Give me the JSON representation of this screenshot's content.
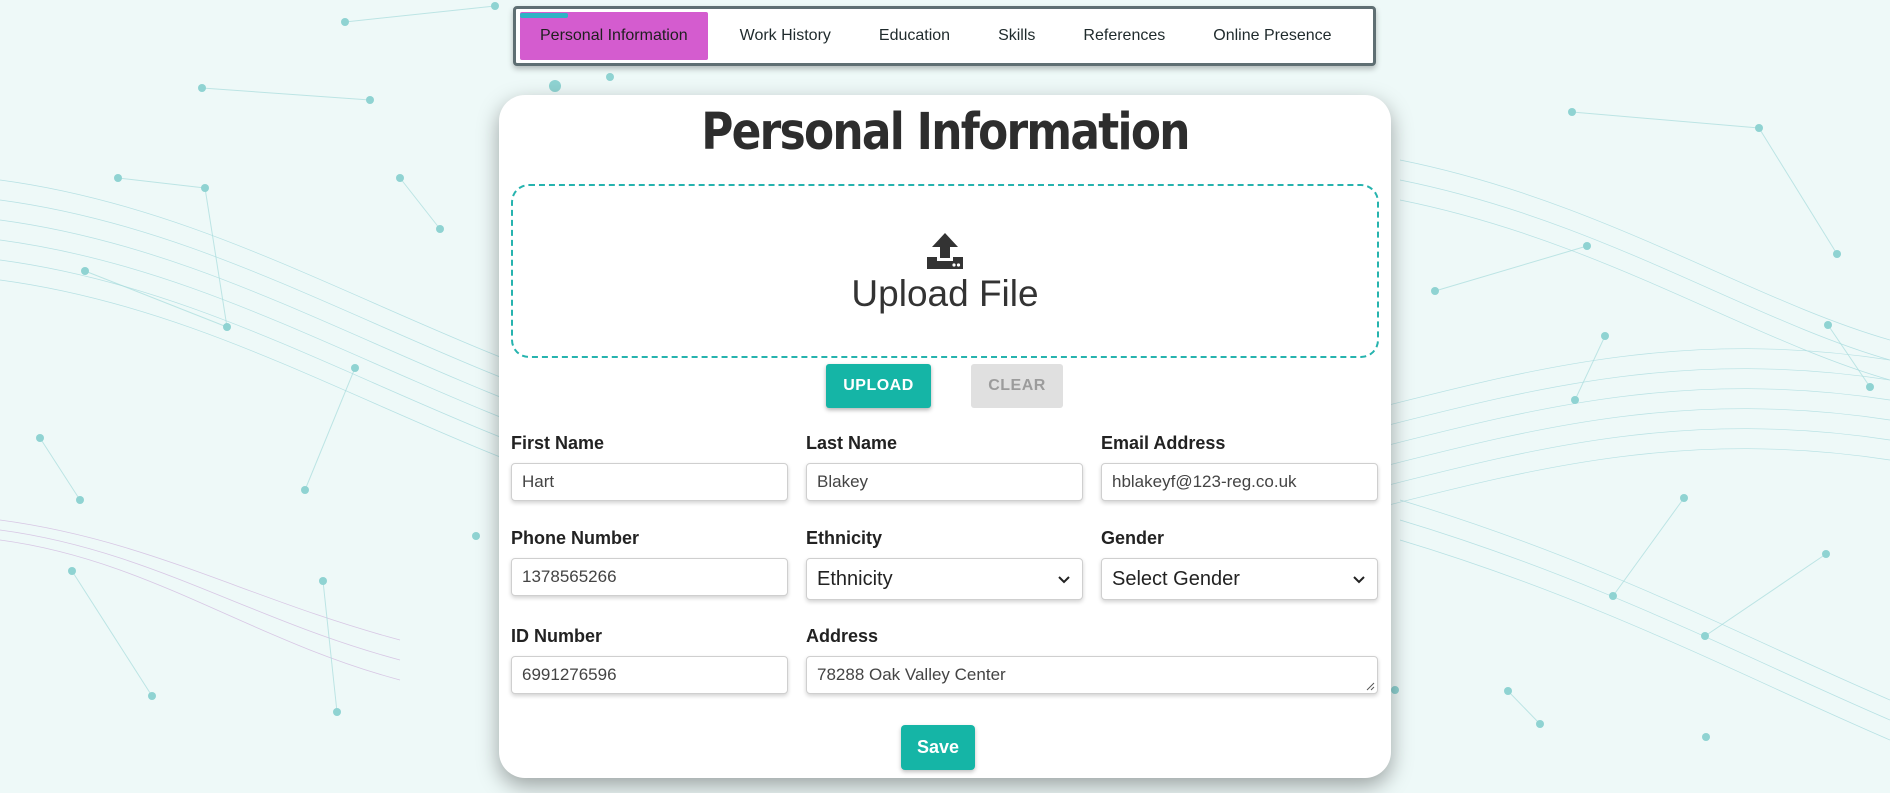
{
  "tabs": [
    {
      "label": "Personal Information",
      "active": true
    },
    {
      "label": "Work History"
    },
    {
      "label": "Education"
    },
    {
      "label": "Skills"
    },
    {
      "label": "References"
    },
    {
      "label": "Online Presence"
    }
  ],
  "page_title": "Personal Information",
  "upload": {
    "drop_label": "Upload File",
    "upload_button": "UPLOAD",
    "clear_button": "CLEAR"
  },
  "fields": {
    "first_name": {
      "label": "First Name",
      "value": "Hart"
    },
    "last_name": {
      "label": "Last Name",
      "value": "Blakey"
    },
    "email": {
      "label": "Email Address",
      "value": "hblakeyf@123-reg.co.uk"
    },
    "phone": {
      "label": "Phone Number",
      "value": "1378565266"
    },
    "ethnicity": {
      "label": "Ethnicity",
      "selected": "Ethnicity"
    },
    "gender": {
      "label": "Gender",
      "selected": "Select Gender"
    },
    "id_number": {
      "label": "ID Number",
      "value": "6991276596"
    },
    "address": {
      "label": "Address",
      "value": "78288 Oak Valley Center"
    }
  },
  "save_button": "Save",
  "colors": {
    "accent": "#15b5a6",
    "active_tab": "#d45ccf",
    "dropzone_border": "#26b3ae"
  }
}
